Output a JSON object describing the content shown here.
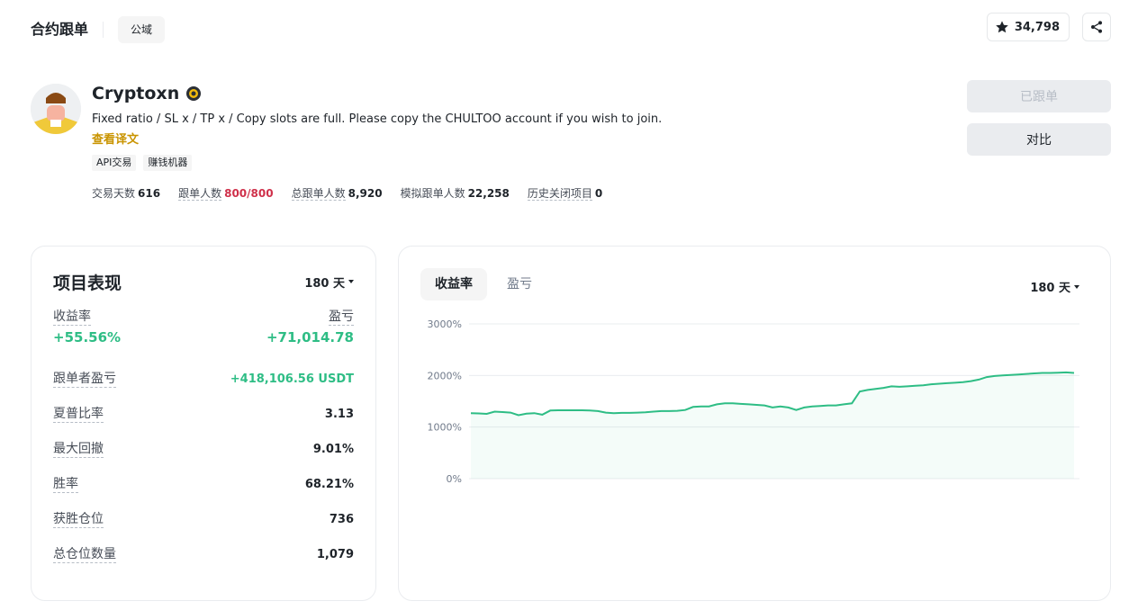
{
  "header": {
    "brand": "合约跟单",
    "scope": "公域",
    "favorites": "34,798",
    "star_icon": "star-icon",
    "share_icon": "share-icon"
  },
  "profile": {
    "name": "Cryptoxn",
    "description": "Fixed ratio / SL x / TP x / Copy slots are full. Please copy the CHULTOO account if you wish to join.",
    "translate_link": "查看译文",
    "tags": [
      "API交易",
      "赚钱机器"
    ],
    "stats": [
      {
        "label": "交易天数",
        "value": "616"
      },
      {
        "label": "跟单人数",
        "value": "800/800"
      },
      {
        "label": "总跟单人数",
        "value": "8,920"
      },
      {
        "label": "模拟跟单人数",
        "value": "22,258"
      },
      {
        "label": "历史关闭项目",
        "value": "0"
      }
    ]
  },
  "actions": {
    "copied": "已跟单",
    "compare": "对比"
  },
  "performance": {
    "title": "项目表现",
    "period": "180 天",
    "roi_label": "收益率",
    "pnl_label": "盈亏",
    "roi_value": "+55.56%",
    "pnl_value": "+71,014.78",
    "metrics": [
      {
        "label": "跟单者盈亏",
        "value": "+418,106.56 USDT"
      },
      {
        "label": "夏普比率",
        "value": "3.13"
      },
      {
        "label": "最大回撤",
        "value": "9.01%"
      },
      {
        "label": "胜率",
        "value": "68.21%"
      },
      {
        "label": "获胜仓位",
        "value": "736"
      },
      {
        "label": "总仓位数量",
        "value": "1,079"
      }
    ]
  },
  "chart_panel": {
    "tabs": [
      "收益率",
      "盈亏"
    ],
    "active_tab": 0,
    "period": "180 天"
  },
  "chart_data": {
    "type": "area",
    "title": "",
    "xlabel": "",
    "ylabel": "",
    "ylim": [
      0,
      3000
    ],
    "yticks": [
      "3000%",
      "2000%",
      "1000%",
      "0%"
    ],
    "ytick_values": [
      3000,
      2000,
      1000,
      0
    ],
    "grid": true,
    "line_color": "#2ebd85",
    "fill_color": "#2ebd85",
    "series": [
      {
        "values": [
          1270,
          1265,
          1255,
          1300,
          1290,
          1280,
          1230,
          1260,
          1270,
          1240,
          1320,
          1325,
          1325,
          1325,
          1325,
          1320,
          1310,
          1280,
          1270,
          1275,
          1275,
          1280,
          1285,
          1300,
          1310,
          1310,
          1315,
          1330,
          1390,
          1400,
          1400,
          1440,
          1460,
          1460,
          1450,
          1440,
          1430,
          1420,
          1380,
          1400,
          1380,
          1330,
          1380,
          1400,
          1410,
          1420,
          1420,
          1440,
          1460,
          1690,
          1720,
          1740,
          1760,
          1790,
          1780,
          1790,
          1800,
          1810,
          1830,
          1840,
          1850,
          1860,
          1870,
          1890,
          1920,
          1970,
          1990,
          2000,
          2010,
          2020,
          2030,
          2040,
          2050,
          2050,
          2055,
          2060,
          2050
        ]
      }
    ]
  }
}
